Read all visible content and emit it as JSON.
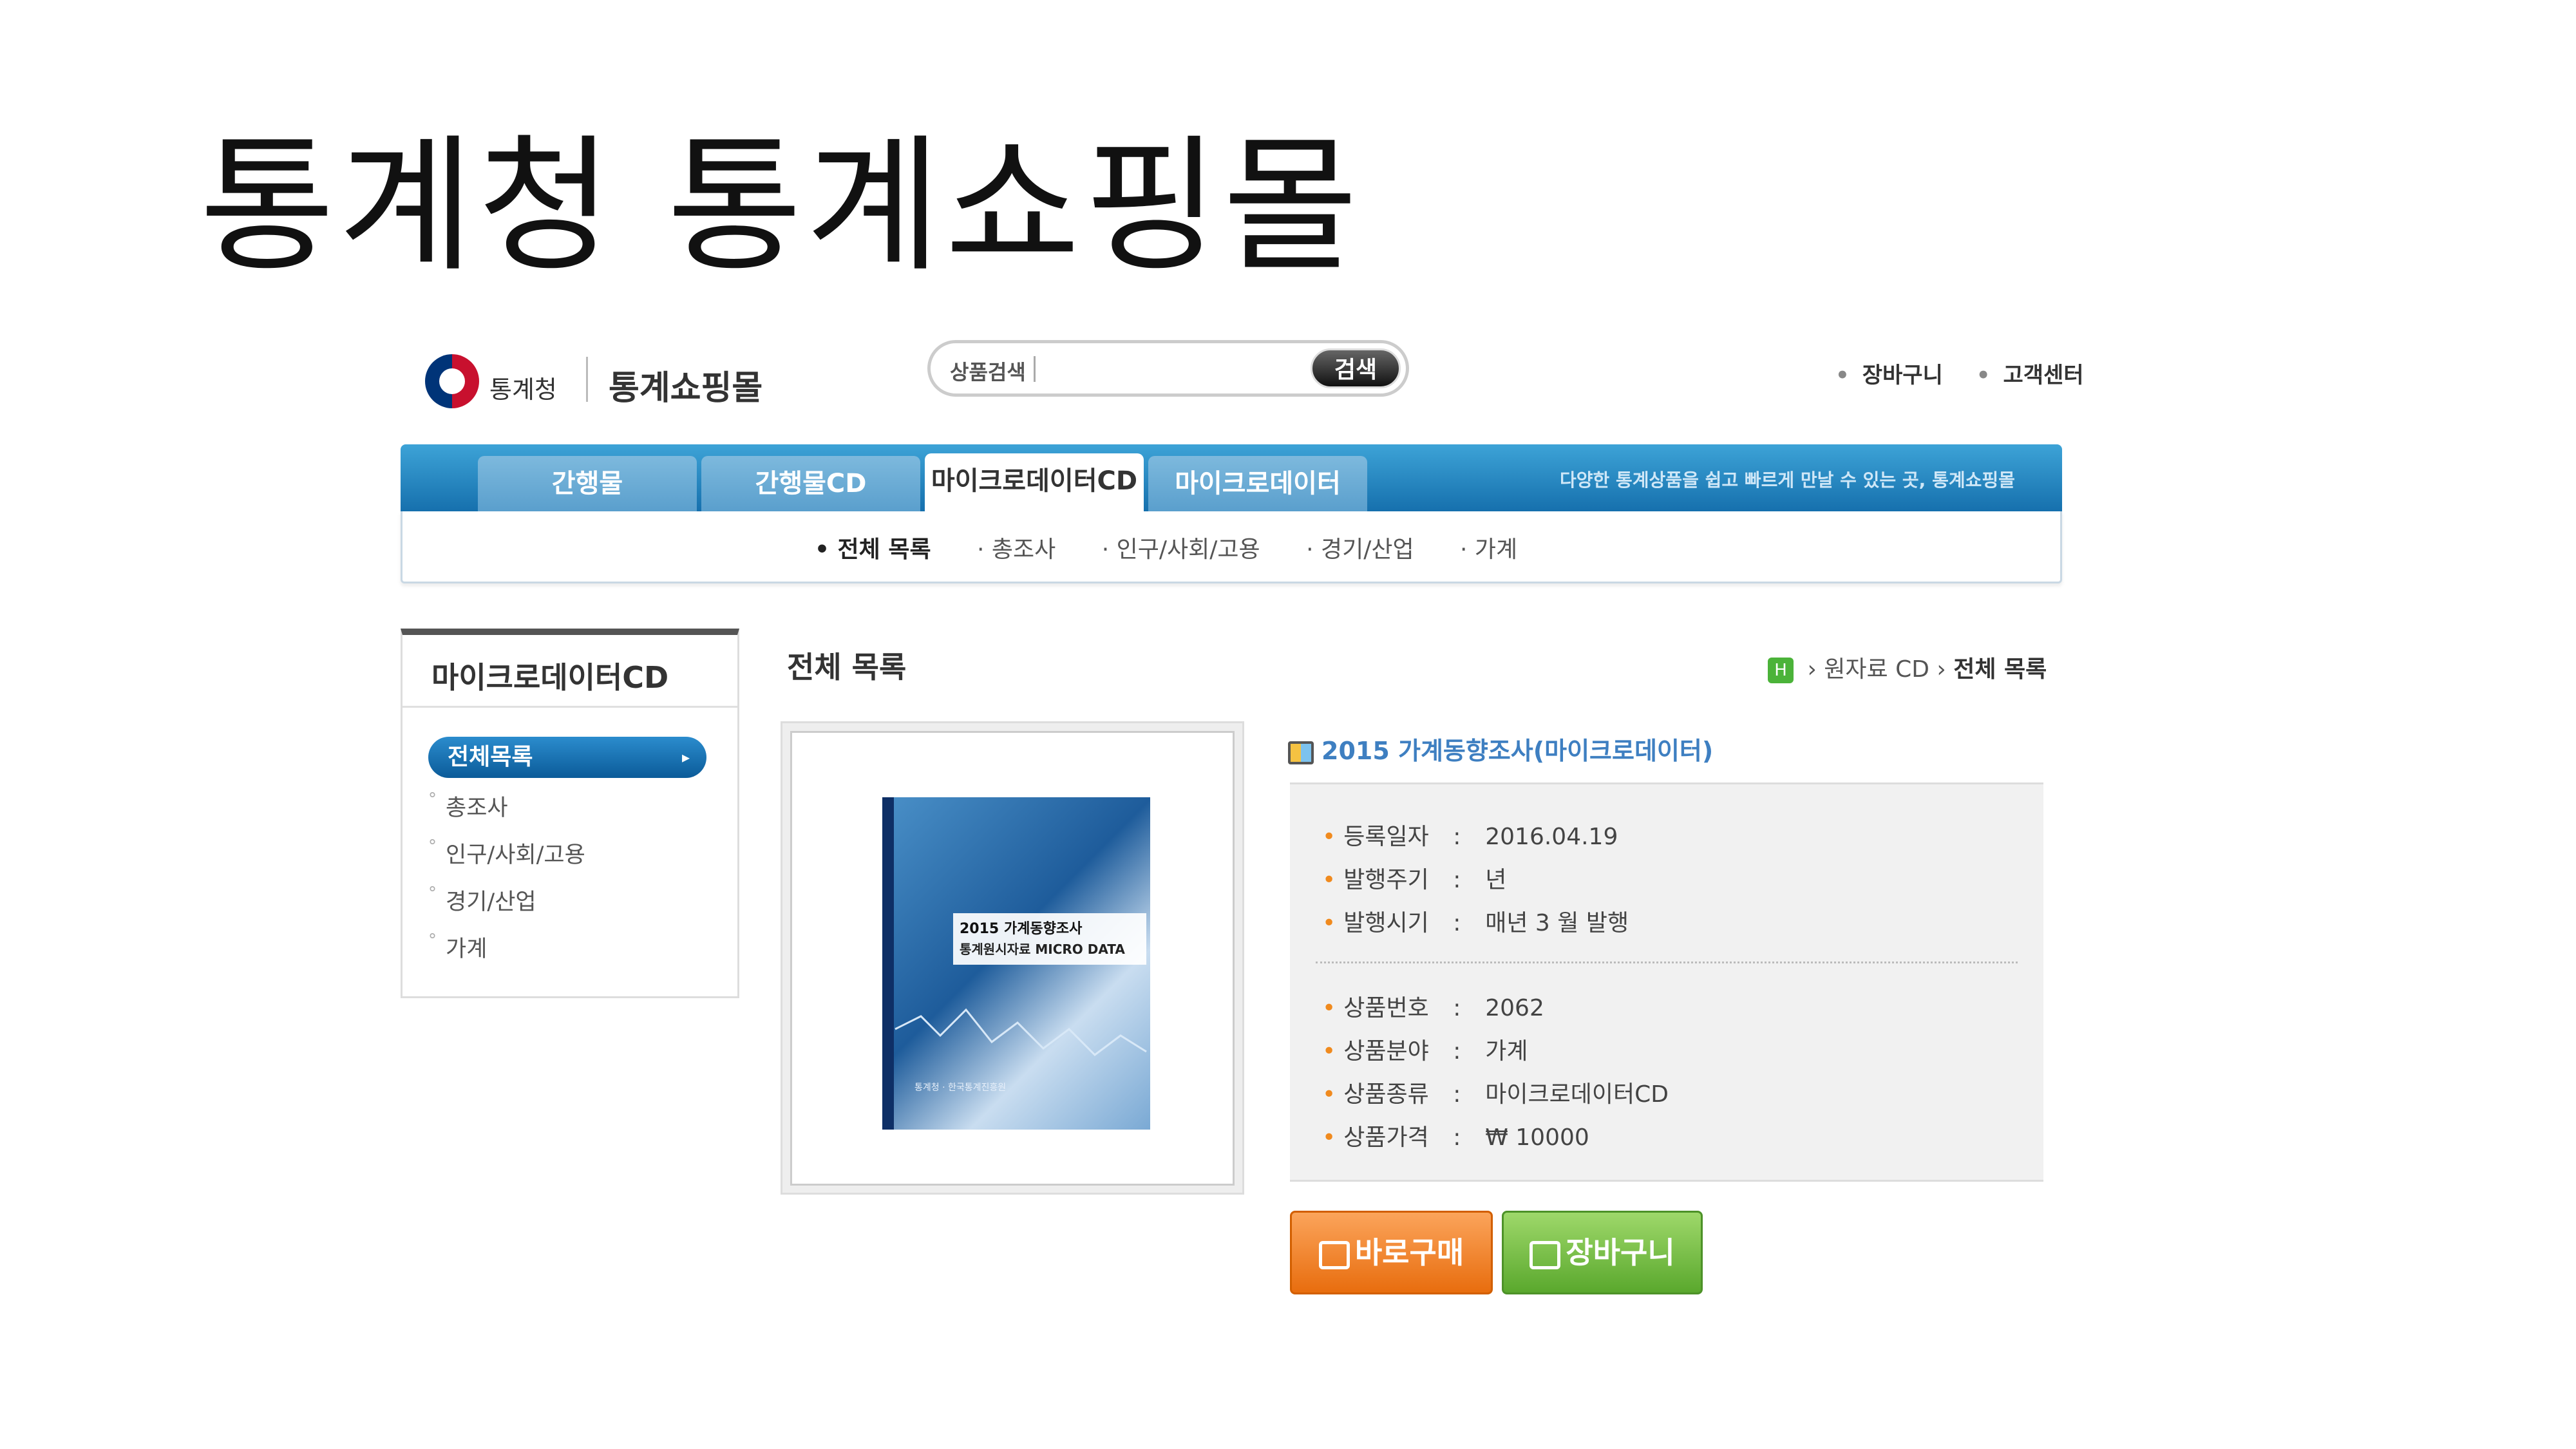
{
  "slide": {
    "title": "통계청 통계쇼핑몰"
  },
  "header": {
    "agency": "통계청",
    "mall_name": "통계쇼핑몰",
    "search_label": "상품검색",
    "search_value": "",
    "search_button": "검색",
    "util_links": [
      "장바구니",
      "고객센터"
    ]
  },
  "nav": {
    "tabs": [
      {
        "label": "간행물"
      },
      {
        "label": "간행물CD"
      },
      {
        "label": "마이크로데이터CD"
      },
      {
        "label": "마이크로데이터"
      }
    ],
    "active_tab": "마이크로데이터CD",
    "slogan": "다양한 통계상품을 쉽고 빠르게 만날 수 있는 곳, 통계쇼핑몰",
    "subnav": [
      "전체 목록",
      "총조사",
      "인구/사회/고용",
      "경기/산업",
      "가계"
    ]
  },
  "sidebar": {
    "title": "마이크로데이터CD",
    "active": "전체목록",
    "items": [
      "총조사",
      "인구/사회/고용",
      "경기/산업",
      "가계"
    ]
  },
  "main": {
    "title": "전체 목록",
    "breadcrumb": [
      "원자료 CD",
      "전체 목록"
    ],
    "cover": {
      "title": "2015 가계동향조사",
      "subtitle": "통계원시자료 MICRO DATA",
      "footer": "통계청 · 한국통계진흥원"
    },
    "product": {
      "title": "2015 가계동향조사(마이크로데이터)",
      "details_a": [
        {
          "label": "등록일자",
          "value": "2016.04.19"
        },
        {
          "label": "발행주기",
          "value": "년"
        },
        {
          "label": "발행시기",
          "value": "매년 3 월 발행"
        }
      ],
      "details_b": [
        {
          "label": "상품번호",
          "value": "2062"
        },
        {
          "label": "상품분야",
          "value": "가계"
        },
        {
          "label": "상품종류",
          "value": "마이크로데이터CD"
        },
        {
          "label": "상품가격",
          "value": "₩ 10000"
        }
      ]
    },
    "buttons": {
      "buy": "바로구매",
      "cart": "장바구니"
    }
  },
  "colors": {
    "nav_blue": "#1670ad",
    "accent_orange": "#e86d0e",
    "accent_green": "#5aa82d",
    "link_blue": "#3e7fc1"
  }
}
